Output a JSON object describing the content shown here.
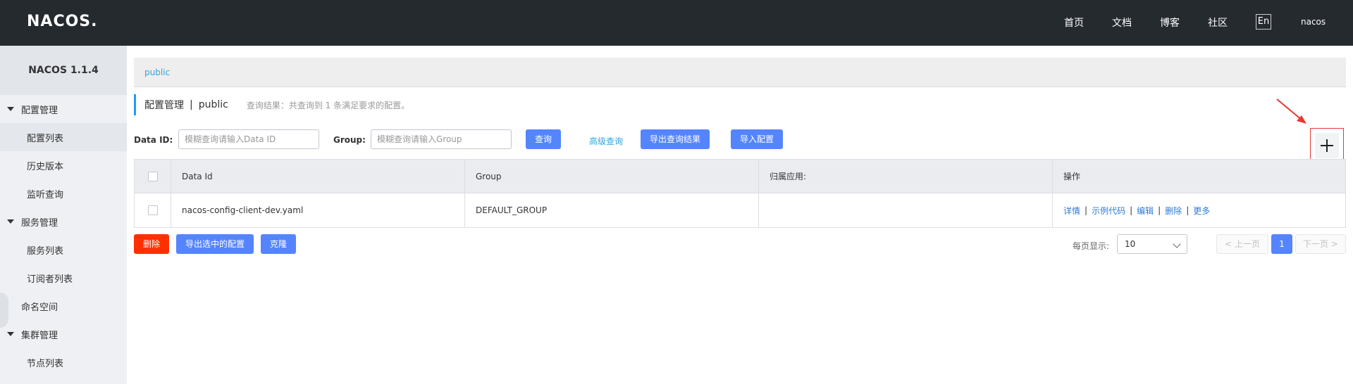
{
  "header": {
    "logo": "NACOS.",
    "nav": [
      "首页",
      "文档",
      "博客",
      "社区"
    ],
    "lang": "En",
    "user": "nacos"
  },
  "sidebar": {
    "version": "NACOS 1.1.4",
    "groups": [
      {
        "label": "配置管理",
        "items": [
          "配置列表",
          "历史版本",
          "监听查询"
        ]
      },
      {
        "label": "服务管理",
        "items": [
          "服务列表",
          "订阅者列表"
        ]
      }
    ],
    "namespace": "命名空间",
    "cluster": {
      "label": "集群管理",
      "items": [
        "节点列表"
      ]
    }
  },
  "breadcrumb": {
    "namespace": "public"
  },
  "page": {
    "title": "配置管理",
    "separator": "|",
    "namespace": "public",
    "result": "查询结果：共查询到 1 条满足要求的配置。"
  },
  "search": {
    "data_id_label": "Data ID:",
    "data_id_placeholder": "模糊查询请输入Data ID",
    "group_label": "Group:",
    "group_placeholder": "模糊查询请输入Group",
    "query": "查询",
    "advanced": "高级查询",
    "export": "导出查询结果",
    "import": "导入配置"
  },
  "add_button": {
    "symbol": "+"
  },
  "table": {
    "columns": [
      "Data Id",
      "Group",
      "归属应用:",
      "操作"
    ],
    "rows": [
      {
        "data_id": "nacos-config-client-dev.yaml",
        "group": "DEFAULT_GROUP",
        "app": ""
      }
    ],
    "ops": [
      "详情",
      "示例代码",
      "编辑",
      "删除",
      "更多"
    ]
  },
  "bulk": {
    "delete": "删除",
    "export_selected": "导出选中的配置",
    "clone": "克隆"
  },
  "pagination": {
    "per_page_label": "每页显示:",
    "per_page": "10",
    "prev": "上一页",
    "current": "1",
    "next": "下一页"
  },
  "colors": {
    "header_bg": "#252a2f",
    "primary": "#5584ff",
    "danger": "#ff3000",
    "link": "#2ca6e0",
    "highlight": "#e53935"
  }
}
